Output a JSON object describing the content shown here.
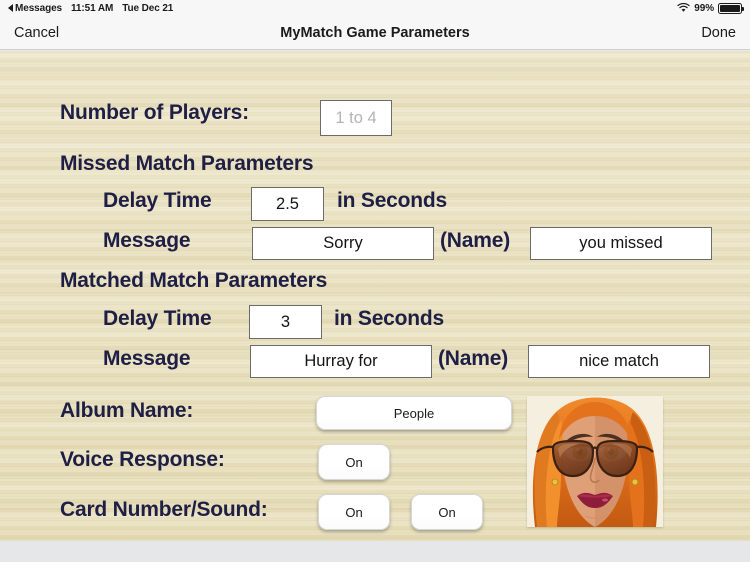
{
  "status_bar": {
    "back_label": "Messages",
    "back_icon": "back-triangle-icon",
    "time": "11:51 AM",
    "date": "Tue Dec 21",
    "wifi_icon": "wifi-icon",
    "battery_percent": "99%",
    "battery_icon": "battery-icon"
  },
  "nav_bar": {
    "cancel_label": "Cancel",
    "title": "MyMatch Game Parameters",
    "done_label": "Done"
  },
  "form": {
    "players": {
      "label": "Number of Players:",
      "value": "",
      "placeholder": "1 to 4"
    },
    "missed_section": {
      "heading": "Missed Match Parameters",
      "delay_label": "Delay Time",
      "delay_value": "2.5",
      "delay_unit": "in Seconds",
      "message_label": "Message",
      "message_prefix": "Sorry",
      "name_token": "(Name)",
      "message_suffix": "you missed"
    },
    "matched_section": {
      "heading": "Matched Match Parameters",
      "delay_label": "Delay Time",
      "delay_value": "3",
      "delay_unit": "in Seconds",
      "message_label": "Message",
      "message_prefix": "Hurray for",
      "name_token": "(Name)",
      "message_suffix": "nice match"
    },
    "album": {
      "label": "Album Name:",
      "value": "People"
    },
    "voice_response": {
      "label": "Voice Response:",
      "value": "On"
    },
    "card_number_sound": {
      "label": "Card Number/Sound:",
      "number_value": "On",
      "sound_value": "On"
    },
    "avatar": {
      "name": "avatar-thumbnail"
    }
  },
  "colors": {
    "label_navy": "#1f1f46",
    "background_wood": "#e9e1bf",
    "chrome_gray": "#f7f7f7",
    "page_gray": "#e6e7e9"
  }
}
